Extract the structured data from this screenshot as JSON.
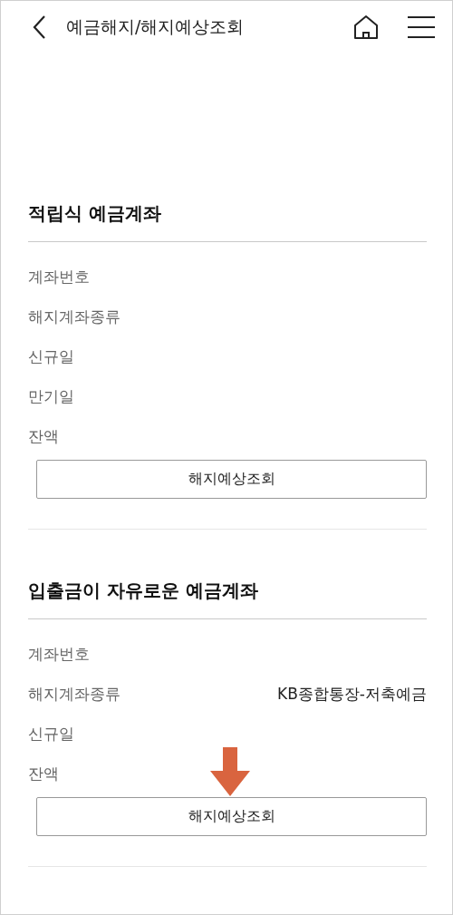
{
  "header": {
    "title": "예금해지/해지예상조회"
  },
  "sections": [
    {
      "title": "적립식 예금계좌",
      "rows": [
        {
          "label": "계좌번호"
        },
        {
          "label": "해지계좌종류"
        },
        {
          "label": "신규일"
        },
        {
          "label": "만기일"
        },
        {
          "label": "잔액"
        }
      ],
      "button": "해지예상조회"
    },
    {
      "title": "입출금이 자유로운 예금계좌",
      "rows": [
        {
          "label": "계좌번호"
        },
        {
          "label": "해지계좌종류",
          "value": "KB종합통장-저축예금"
        },
        {
          "label": "신규일"
        },
        {
          "label": "잔액"
        }
      ],
      "button": "해지예상조회",
      "annotations": [
        {
          "kind": "down-arrow"
        }
      ]
    }
  ]
}
